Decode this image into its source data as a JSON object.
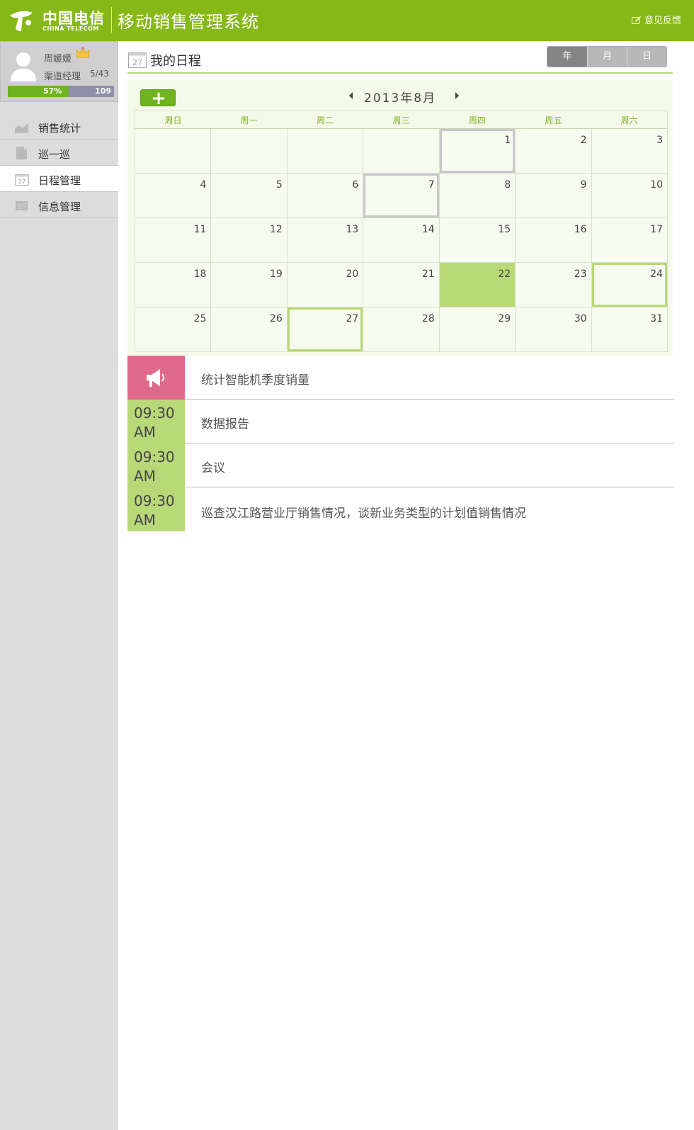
{
  "header": {
    "logo_cn": "中国电信",
    "logo_en": "CHINA TELECOM",
    "app_title": "移动销售管理系统",
    "feedback_label": "意见反馈"
  },
  "user": {
    "name": "周媛媛",
    "role": "渠道经理",
    "ratio": "5/43",
    "progress_label": "57%",
    "progress_fraction": 0.57,
    "total": "109"
  },
  "nav": {
    "items": [
      {
        "label": "销售统计",
        "icon": "chart-icon"
      },
      {
        "label": "巡一巡",
        "icon": "document-icon"
      },
      {
        "label": "日程管理",
        "icon": "calendar-icon",
        "active": true
      },
      {
        "label": "信息管理",
        "icon": "message-icon"
      }
    ]
  },
  "page": {
    "title": "我的日程",
    "calendar_icon_day": "27",
    "views": [
      "年",
      "月",
      "日"
    ],
    "active_view": "年"
  },
  "calendar": {
    "month_label": "2013年8月",
    "add_label": "+",
    "weekdays": [
      "周日",
      "周一",
      "周二",
      "周三",
      "周四",
      "周五",
      "周六"
    ],
    "weeks": [
      [
        "",
        "",
        "",
        "",
        "1",
        "2",
        "3"
      ],
      [
        "4",
        "5",
        "6",
        "7",
        "8",
        "9",
        "10"
      ],
      [
        "11",
        "12",
        "13",
        "14",
        "15",
        "16",
        "17"
      ],
      [
        "18",
        "19",
        "20",
        "21",
        "22",
        "23",
        "24"
      ],
      [
        "25",
        "26",
        "27",
        "28",
        "29",
        "30",
        "31"
      ]
    ],
    "today": "22",
    "marked_days": [
      "24",
      "27"
    ],
    "marked_gray_days": [
      "1",
      "7"
    ]
  },
  "events": [
    {
      "type": "notice",
      "icon": "megaphone-icon",
      "title": "统计智能机季度销量"
    },
    {
      "type": "timed",
      "time": "09:30",
      "ampm": "AM",
      "title": "数据报告"
    },
    {
      "type": "timed",
      "time": "09:30",
      "ampm": "AM",
      "title": "会议"
    },
    {
      "type": "timed",
      "time": "09:30",
      "ampm": "AM",
      "title": "巡查汉江路营业厅销售情况，谈新业务类型的计划值销售情况"
    }
  ],
  "colors": {
    "brand_green": "#86b817",
    "accent_green": "#b9d877",
    "notice_pink": "#e06a8a"
  }
}
